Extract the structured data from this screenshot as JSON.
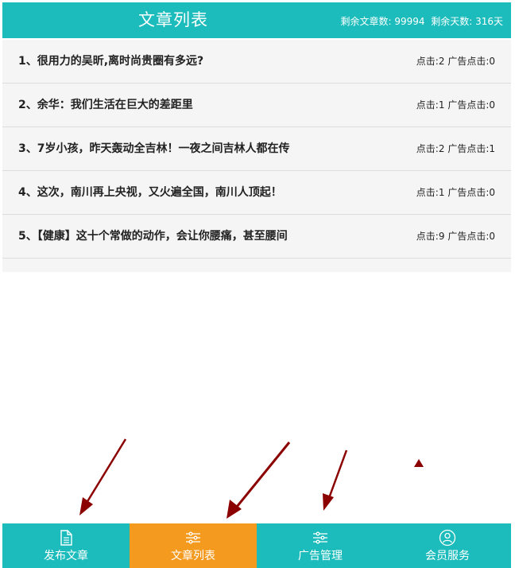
{
  "header": {
    "title": "文章列表",
    "remaining_articles_label": "剩余文章数:",
    "remaining_articles": "99994",
    "remaining_days_label": "剩余天数:",
    "remaining_days": "316天"
  },
  "articles": [
    {
      "title": "1、很用力的吴昕,离时尚贵圈有多远?",
      "clicks": "点击:2",
      "ad_clicks": "广告点击:0"
    },
    {
      "title": "2、余华：我们生活在巨大的差距里",
      "clicks": "点击:1",
      "ad_clicks": "广告点击:0"
    },
    {
      "title": "3、7岁小孩，昨天轰动全吉林！一夜之间吉林人都在传",
      "clicks": "点击:2",
      "ad_clicks": "广告点击:1"
    },
    {
      "title": "4、这次，南川再上央视，又火遍全国，南川人顶起！",
      "clicks": "点击:1",
      "ad_clicks": "广告点击:0"
    },
    {
      "title": "5、【健康】这十个常做的动作，会让你腰痛，甚至腰间",
      "clicks": "点击:9",
      "ad_clicks": "广告点击:0"
    }
  ],
  "tabs": [
    {
      "label": "发布文章",
      "icon": "document-icon"
    },
    {
      "label": "文章列表",
      "icon": "list-icon"
    },
    {
      "label": "广告管理",
      "icon": "list-icon"
    },
    {
      "label": "会员服务",
      "icon": "user-icon"
    }
  ],
  "colors": {
    "accent": "#1cbcbc",
    "active_tab": "#f39a1f",
    "annotation_arrow": "#8b0000"
  }
}
